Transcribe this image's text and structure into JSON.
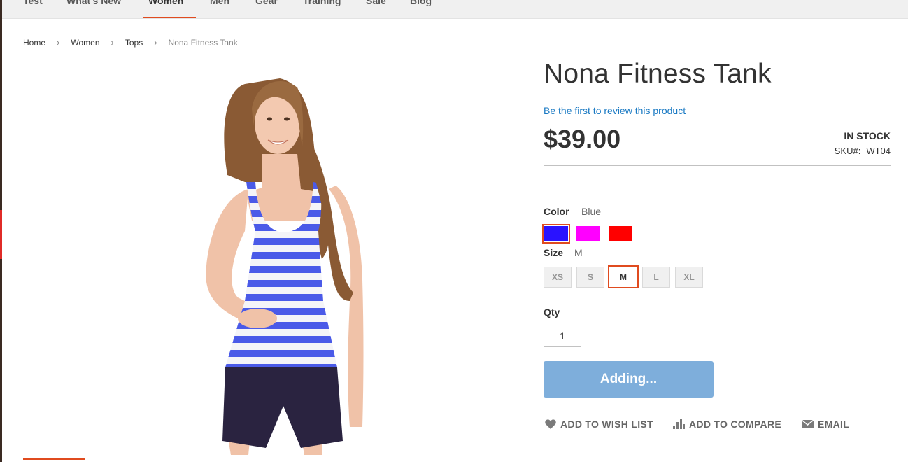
{
  "nav": {
    "items": [
      "Test",
      "What's New",
      "Women",
      "Men",
      "Gear",
      "Training",
      "Sale",
      "Blog"
    ],
    "active": "Women"
  },
  "breadcrumb": {
    "home": "Home",
    "women": "Women",
    "tops": "Tops",
    "current": "Nona Fitness Tank",
    "separator": "›"
  },
  "product": {
    "title": "Nona Fitness Tank",
    "review_link": "Be the first to review this product",
    "price": "$39.00",
    "stock": "IN STOCK",
    "sku_label": "SKU#:",
    "sku": "WT04"
  },
  "options": {
    "color_label": "Color",
    "color_selected": "Blue",
    "colors": [
      {
        "name": "Blue",
        "hex": "#2a12ff"
      },
      {
        "name": "Purple",
        "hex": "#ff00ff"
      },
      {
        "name": "Red",
        "hex": "#ff0000"
      }
    ],
    "size_label": "Size",
    "size_selected": "M",
    "sizes": [
      "XS",
      "S",
      "M",
      "L",
      "XL"
    ]
  },
  "qty": {
    "label": "Qty",
    "value": "1"
  },
  "cart_button": {
    "label": "Adding..."
  },
  "actions": {
    "wishlist": "ADD TO WISH LIST",
    "compare": "ADD TO COMPARE",
    "email": "EMAIL"
  },
  "colors": {
    "accent": "#e04b1f",
    "link": "#1979c3",
    "button": "#7eaedb"
  }
}
